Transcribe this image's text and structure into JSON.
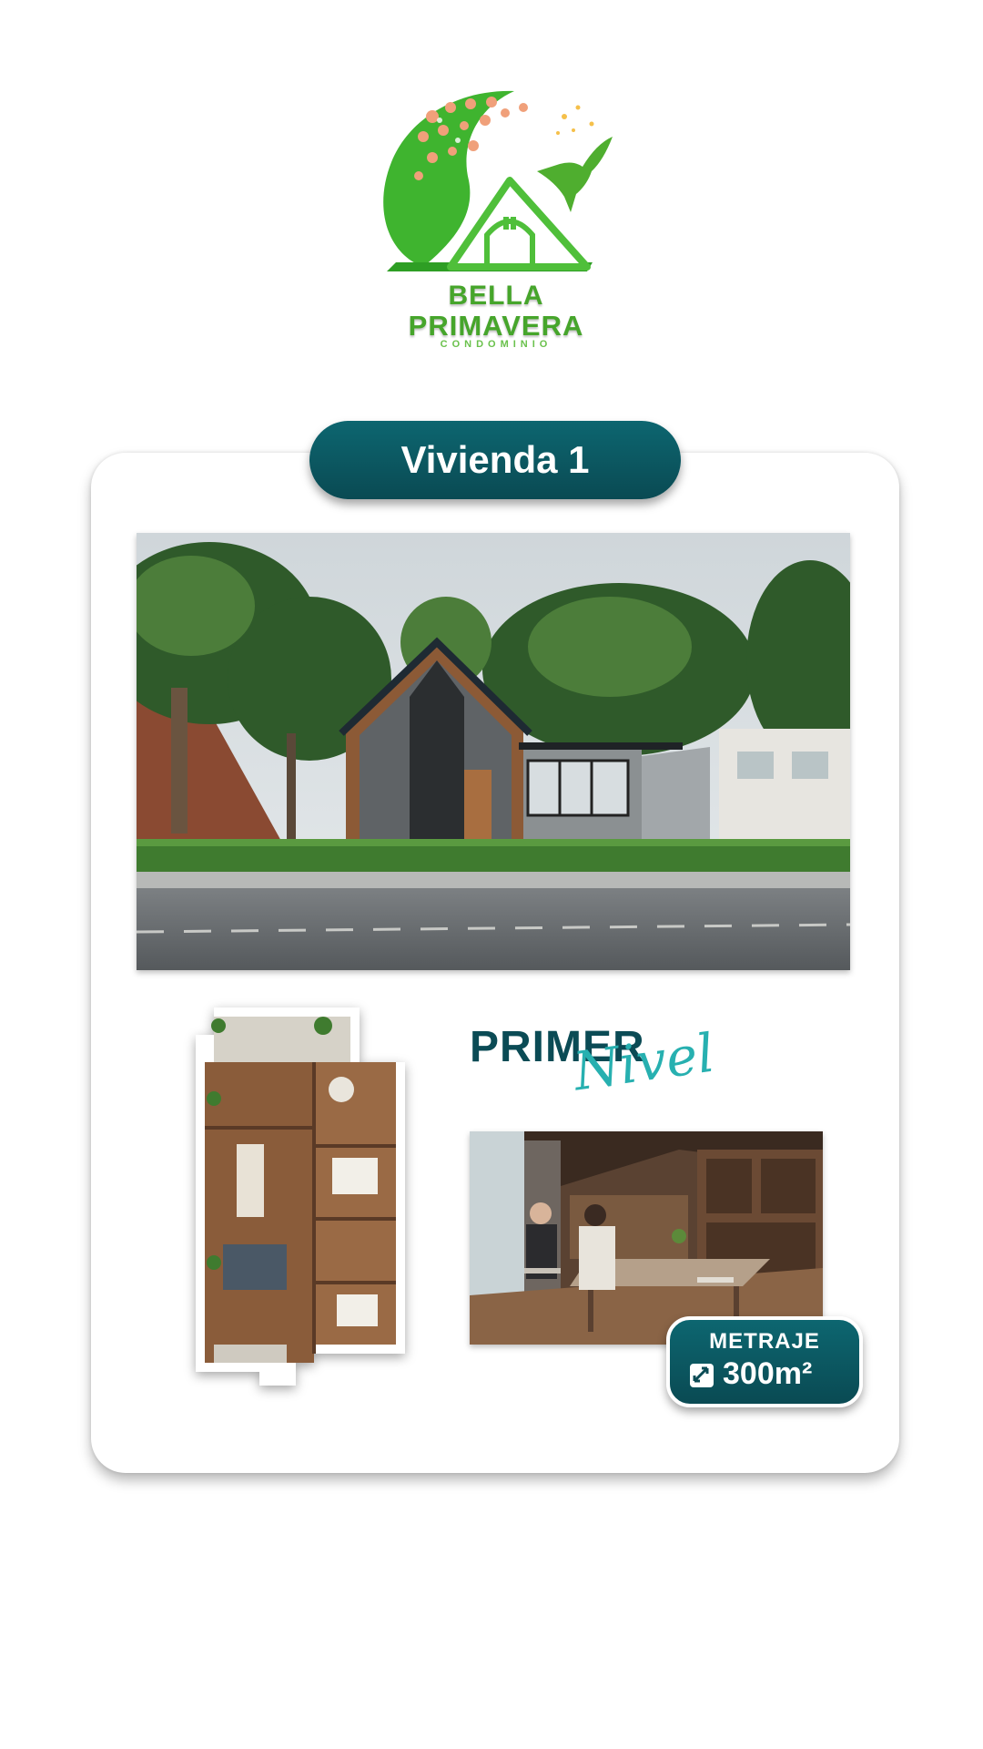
{
  "logo": {
    "line1": "BELLA",
    "line2": "PRIMAVERA",
    "line3": "CONDOMINIO"
  },
  "card": {
    "title": "Vivienda 1"
  },
  "level": {
    "heading": "PRIMER",
    "script": "Nivel"
  },
  "metraje": {
    "label": "METRAJE",
    "value": "300m²"
  },
  "colors": {
    "brand_green": "#46a52b",
    "accent_teal": "#0b4b55",
    "script_teal": "#27b0b0"
  },
  "icons": {
    "area": "area-measure-icon",
    "hummingbird": "hummingbird-icon",
    "house": "house-icon"
  }
}
